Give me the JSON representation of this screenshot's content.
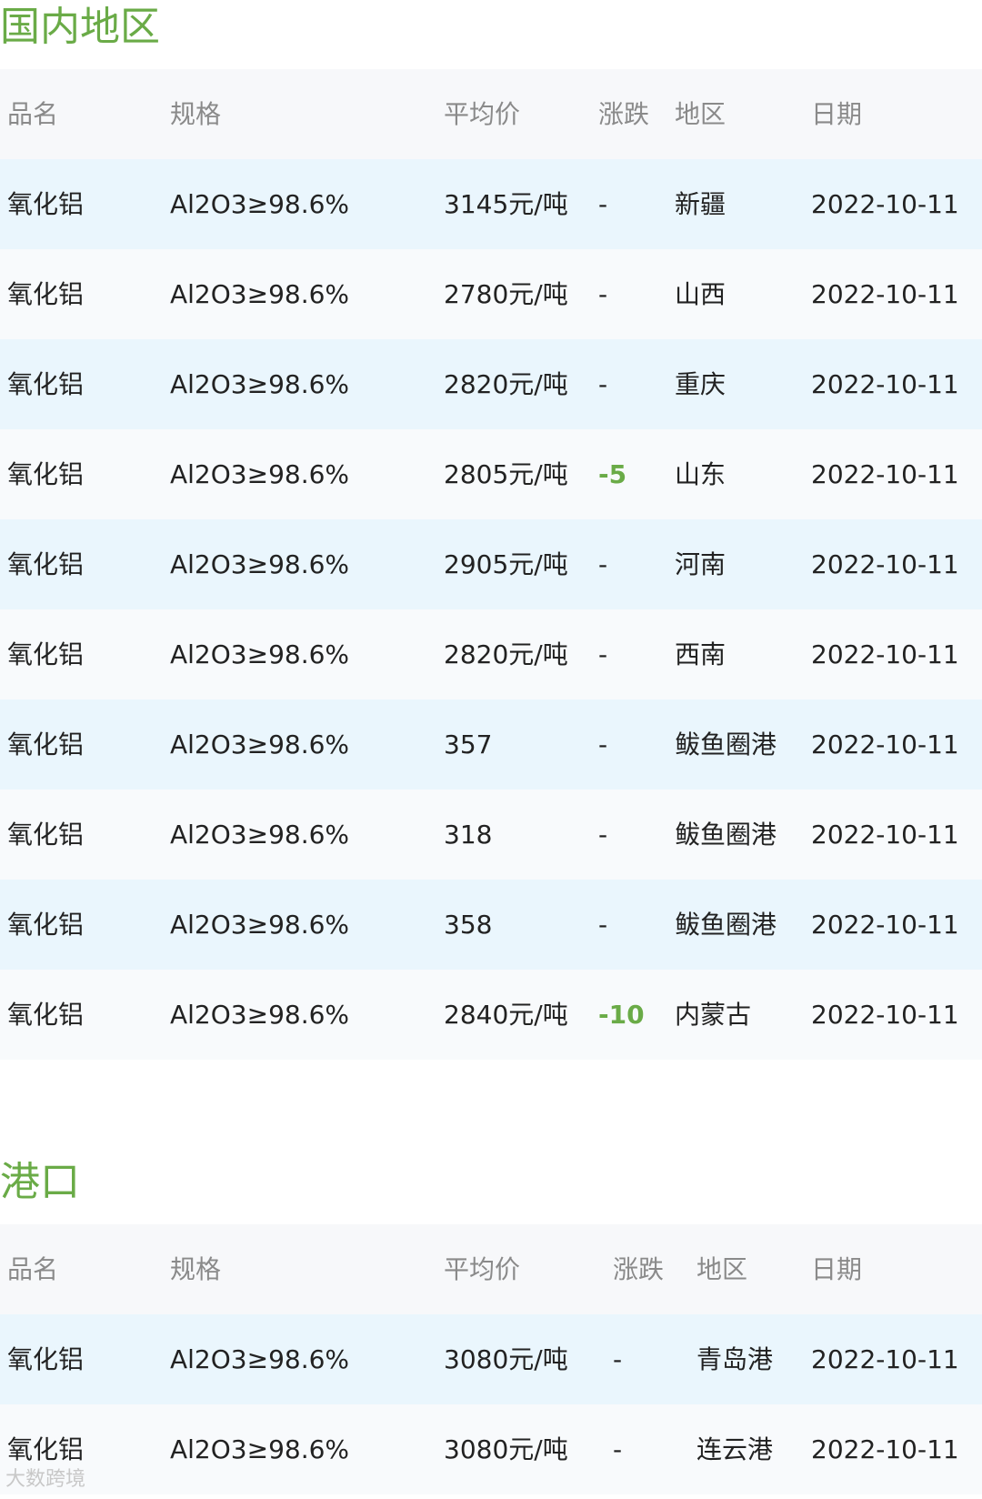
{
  "domestic": {
    "title": "国内地区",
    "headers": [
      "品名",
      "规格",
      "平均价",
      "涨跌",
      "地区",
      "日期"
    ],
    "rows": [
      {
        "name": "氧化铝",
        "spec": "Al2O3≥98.6%",
        "price": "3145元/吨",
        "change": "-",
        "region": "新疆",
        "date": "2022-10-11"
      },
      {
        "name": "氧化铝",
        "spec": "Al2O3≥98.6%",
        "price": "2780元/吨",
        "change": "-",
        "region": "山西",
        "date": "2022-10-11"
      },
      {
        "name": "氧化铝",
        "spec": "Al2O3≥98.6%",
        "price": "2820元/吨",
        "change": "-",
        "region": "重庆",
        "date": "2022-10-11"
      },
      {
        "name": "氧化铝",
        "spec": "Al2O3≥98.6%",
        "price": "2805元/吨",
        "change": "-5",
        "region": "山东",
        "date": "2022-10-11"
      },
      {
        "name": "氧化铝",
        "spec": "Al2O3≥98.6%",
        "price": "2905元/吨",
        "change": "-",
        "region": "河南",
        "date": "2022-10-11"
      },
      {
        "name": "氧化铝",
        "spec": "Al2O3≥98.6%",
        "price": "2820元/吨",
        "change": "-",
        "region": "西南",
        "date": "2022-10-11"
      },
      {
        "name": "氧化铝",
        "spec": "Al2O3≥98.6%",
        "price": "357",
        "change": "-",
        "region": "鲅鱼圈港",
        "date": "2022-10-11"
      },
      {
        "name": "氧化铝",
        "spec": "Al2O3≥98.6%",
        "price": "318",
        "change": "-",
        "region": "鲅鱼圈港",
        "date": "2022-10-11"
      },
      {
        "name": "氧化铝",
        "spec": "Al2O3≥98.6%",
        "price": "358",
        "change": "-",
        "region": "鲅鱼圈港",
        "date": "2022-10-11"
      },
      {
        "name": "氧化铝",
        "spec": "Al2O3≥98.6%",
        "price": "2840元/吨",
        "change": "-10",
        "region": "内蒙古",
        "date": "2022-10-11"
      }
    ]
  },
  "port": {
    "title": "港口",
    "headers": [
      "品名",
      "规格",
      "平均价",
      "涨跌",
      "地区",
      "日期"
    ],
    "rows": [
      {
        "name": "氧化铝",
        "spec": "Al2O3≥98.6%",
        "price": "3080元/吨",
        "change": "-",
        "region": "青岛港",
        "date": "2022-10-11"
      },
      {
        "name": "氧化铝",
        "spec": "Al2O3≥98.6%",
        "price": "3080元/吨",
        "change": "-",
        "region": "连云港",
        "date": "2022-10-11"
      }
    ]
  },
  "watermark": "大数跨境",
  "colors": {
    "accent": "#6aab47",
    "header_bg": "#f7f8fa",
    "stripe_bg": "#eaf6fd"
  }
}
